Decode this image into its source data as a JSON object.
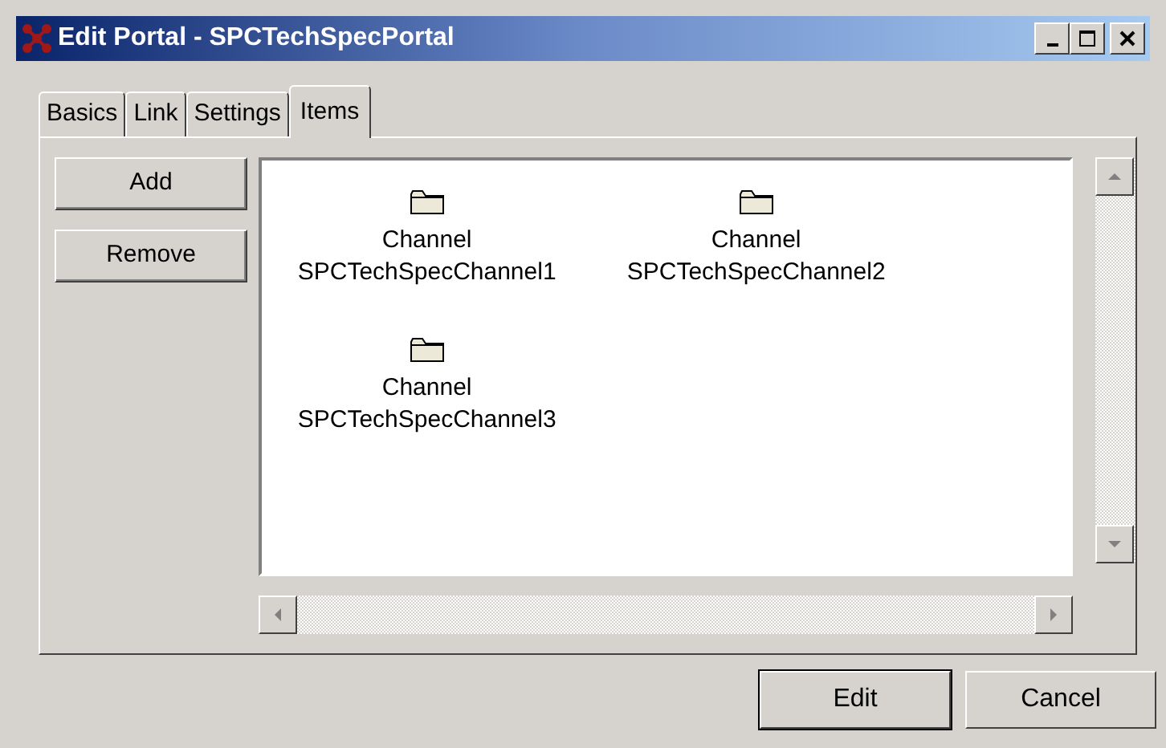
{
  "window": {
    "title": "Edit Portal - SPCTechSpecPortal"
  },
  "tabs": [
    {
      "label": "Basics",
      "selected": false
    },
    {
      "label": "Link",
      "selected": false
    },
    {
      "label": "Settings",
      "selected": false
    },
    {
      "label": "Items",
      "selected": true
    }
  ],
  "side_buttons": [
    "Add",
    "Remove"
  ],
  "items": [
    {
      "type": "Channel",
      "name": "SPCTechSpecChannel1"
    },
    {
      "type": "Channel",
      "name": "SPCTechSpecChannel2"
    },
    {
      "type": "Channel",
      "name": "SPCTechSpecChannel3"
    }
  ],
  "buttons": [
    {
      "label": "Edit",
      "default": true
    },
    {
      "label": "Cancel",
      "default": false
    }
  ]
}
